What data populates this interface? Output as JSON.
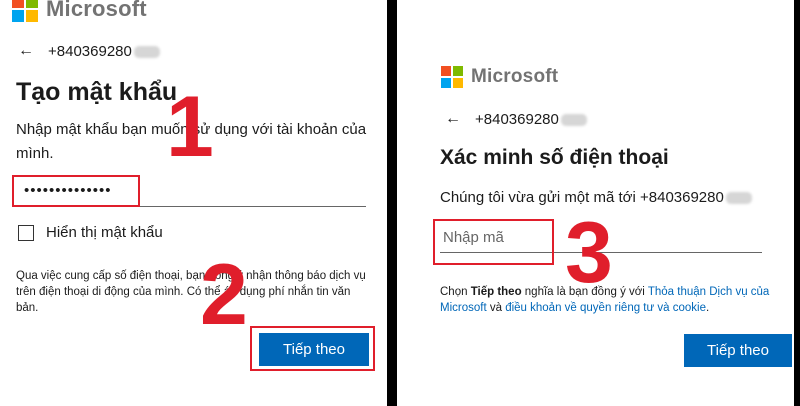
{
  "left": {
    "logo_text": "Microsoft",
    "phone_prefix": "+840369280",
    "title": "Tạo mật khẩu",
    "description": "Nhập mật khẩu bạn muốn sử dụng với tài khoản của mình.",
    "password_value": "••••••••••••••",
    "show_password_label": "Hiển thị mật khẩu",
    "terms_text": "Qua việc cung cấp số điện thoại, bạn đồng ý nhận thông báo dịch vụ trên điện thoại di động của mình. Có thể áp dụng phí nhắn tin văn bản.",
    "next_button": "Tiếp theo",
    "annotation_1": "1",
    "annotation_2": "2"
  },
  "right": {
    "logo_text": "Microsoft",
    "phone_prefix": "+840369280",
    "title": "Xác minh số điện thoại",
    "description_prefix": "Chúng tôi vừa gửi một mã tới +840369280",
    "code_placeholder": "Nhập mã",
    "terms_prefix": "Chọn ",
    "terms_bold": "Tiếp theo",
    "terms_mid": " nghĩa là bạn đồng ý với ",
    "terms_link_1": "Thỏa thuận Dịch vụ của Microsoft",
    "terms_and": " và ",
    "terms_link_2": "điều khoản về quyền riêng tư và cookie",
    "terms_end": ".",
    "next_button": "Tiếp theo",
    "annotation_3": "3"
  },
  "colors": {
    "ms_red": "#f25022",
    "ms_green": "#7fba00",
    "ms_blue": "#00a4ef",
    "ms_yellow": "#ffb900",
    "button_blue": "#0067b8",
    "annotation_red": "#e01e2b"
  },
  "icons": {
    "back": "back-arrow-icon",
    "logo": "microsoft-logo-icon"
  }
}
